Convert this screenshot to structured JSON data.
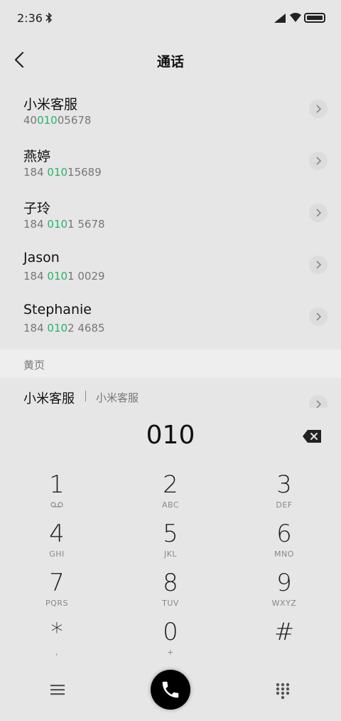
{
  "status_bar": {
    "time": "2:36"
  },
  "header": {
    "title": "通话"
  },
  "contacts": [
    {
      "name": "小米客服",
      "num_pre": "40",
      "num_hl": "010",
      "num_post": "05678"
    },
    {
      "name": "燕婷",
      "num_pre": "184 ",
      "num_hl": "010",
      "num_post": "15689"
    },
    {
      "name": "子玲",
      "num_pre": "184 ",
      "num_hl": "010",
      "num_post": "1 5678"
    },
    {
      "name": "Jason",
      "num_pre": "184 ",
      "num_hl": "010",
      "num_post": "1 0029"
    },
    {
      "name": "Stephanie",
      "num_pre": "184 ",
      "num_hl": "010",
      "num_post": "2 4685"
    }
  ],
  "yellow_pages": {
    "label": "黄页",
    "item_name": "小米客服",
    "item_sub": "小米客服"
  },
  "dialer": {
    "input": "010",
    "keys": [
      {
        "digit": "1",
        "letters": ""
      },
      {
        "digit": "2",
        "letters": "ABC"
      },
      {
        "digit": "3",
        "letters": "DEF"
      },
      {
        "digit": "4",
        "letters": "GHI"
      },
      {
        "digit": "5",
        "letters": "JKL"
      },
      {
        "digit": "6",
        "letters": "MNO"
      },
      {
        "digit": "7",
        "letters": "PQRS"
      },
      {
        "digit": "8",
        "letters": "TUV"
      },
      {
        "digit": "9",
        "letters": "WXYZ"
      },
      {
        "digit": "*",
        "letters": ","
      },
      {
        "digit": "0",
        "letters": "+"
      },
      {
        "digit": "#",
        "letters": ""
      }
    ]
  },
  "colors": {
    "highlight": "#27b36a",
    "background": "#e6e6e6",
    "section": "#eeeeee"
  },
  "icons": [
    "bluetooth-icon",
    "signal-icon",
    "wifi-icon",
    "battery-icon",
    "back-icon",
    "chevron-right-icon",
    "backspace-icon",
    "voicemail-icon",
    "menu-icon",
    "phone-icon",
    "keypad-icon"
  ]
}
